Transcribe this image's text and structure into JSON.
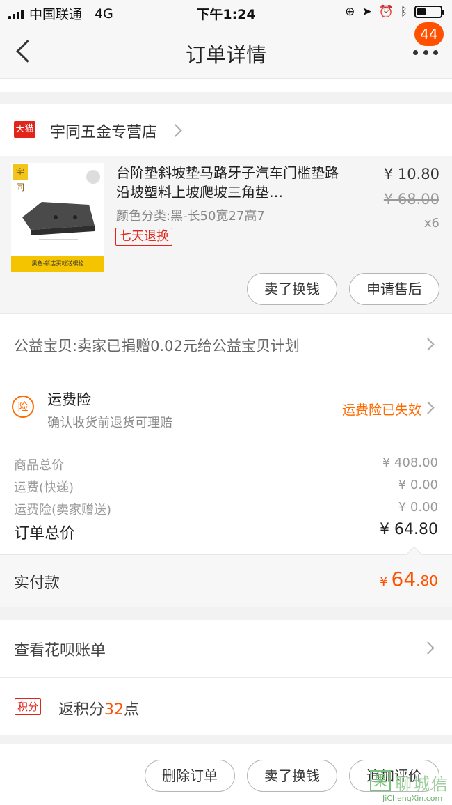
{
  "status_bar": {
    "carrier": "中国联通",
    "network": "4G",
    "time": "下午1:24"
  },
  "nav": {
    "title": "订单详情",
    "badge_count": "44"
  },
  "shop": {
    "platform_tag": "天猫",
    "name": "宇同五金专营店"
  },
  "item": {
    "image_logo": "宇同",
    "image_strip_text": "黑色-新店买就送螺栓",
    "title": "台阶垫斜坡垫马路牙子汽车门槛垫路沿坡塑料上坡爬坡三角垫…",
    "sku": "颜色分类:黑-长50宽27高7",
    "return_tag": "七天退换",
    "price": "¥ 10.80",
    "original_price": "¥ 68.00",
    "quantity": "x6",
    "actions": [
      "卖了换钱",
      "申请售后"
    ]
  },
  "charity": {
    "text": "公益宝贝:卖家已捐赠0.02元给公益宝贝计划"
  },
  "insurance": {
    "icon_char": "险",
    "title": "运费险",
    "subtitle": "确认收货前退货可理赔",
    "status": "运费险已失效"
  },
  "summary": {
    "rows": [
      {
        "label": "商品总价",
        "value": "¥ 408.00"
      },
      {
        "label": "运费(快递)",
        "value": "¥ 0.00"
      },
      {
        "label": "运费险(卖家赠送)",
        "value": "¥ 0.00"
      }
    ],
    "total_label": "订单总价",
    "total_value": "¥ 64.80"
  },
  "paid": {
    "label": "实付款",
    "currency": "¥",
    "amount_int": "64",
    "amount_dec": ".80"
  },
  "huabei": {
    "text": "查看花呗账单"
  },
  "points": {
    "tag": "积分",
    "prefix": "返积分",
    "value": "32",
    "suffix": "点"
  },
  "bottom_actions": [
    "删除订单",
    "卖了换钱",
    "追加评价"
  ],
  "watermark": {
    "glyph": "果",
    "cn": "聊城信",
    "en": "JiChengXin.com"
  },
  "colors": {
    "accent": "#ff5000",
    "tmall_red": "#e1251b",
    "insurance_orange": "#ff6a00"
  },
  "icons": [
    "back-arrow-icon",
    "more-dots-icon",
    "chevron-right-icon",
    "insurance-icon",
    "tmall-icon"
  ]
}
